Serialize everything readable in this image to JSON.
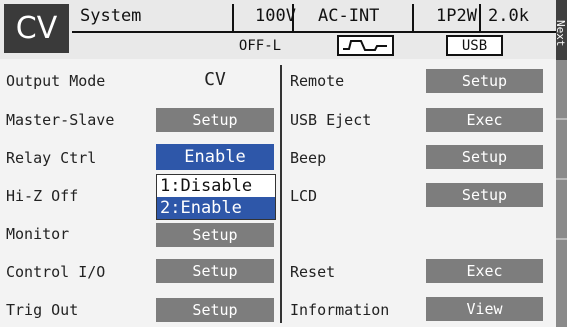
{
  "header": {
    "mode": "CV",
    "title": "System",
    "voltage": "100V",
    "source": "AC-INT",
    "wiring": "1P2W",
    "range": "2.0k",
    "output_state": "OFF-L",
    "usb": "USB",
    "waveform_icon": "sine-wave-icon"
  },
  "side": {
    "next": "Next"
  },
  "left": {
    "output_mode": {
      "label": "Output Mode",
      "value": "CV"
    },
    "master_slave": {
      "label": "Master-Slave",
      "button": "Setup"
    },
    "relay_ctrl": {
      "label": "Relay Ctrl",
      "value": "Enable"
    },
    "hi_z_off": {
      "label": "Hi-Z Off"
    },
    "monitor": {
      "label": "Monitor",
      "button": "Setup"
    },
    "control_io": {
      "label": "Control I/O",
      "button": "Setup"
    },
    "trig_out": {
      "label": "Trig Out",
      "button": "Setup"
    }
  },
  "dropdown": {
    "options": [
      "1:Disable",
      "2:Enable"
    ],
    "selected": "2:Enable"
  },
  "right": {
    "remote": {
      "label": "Remote",
      "button": "Setup"
    },
    "usb_eject": {
      "label": "USB Eject",
      "button": "Exec"
    },
    "beep": {
      "label": "Beep",
      "button": "Setup"
    },
    "lcd": {
      "label": "LCD",
      "button": "Setup"
    },
    "reset": {
      "label": "Reset",
      "button": "Exec"
    },
    "information": {
      "label": "Information",
      "button": "View"
    }
  }
}
